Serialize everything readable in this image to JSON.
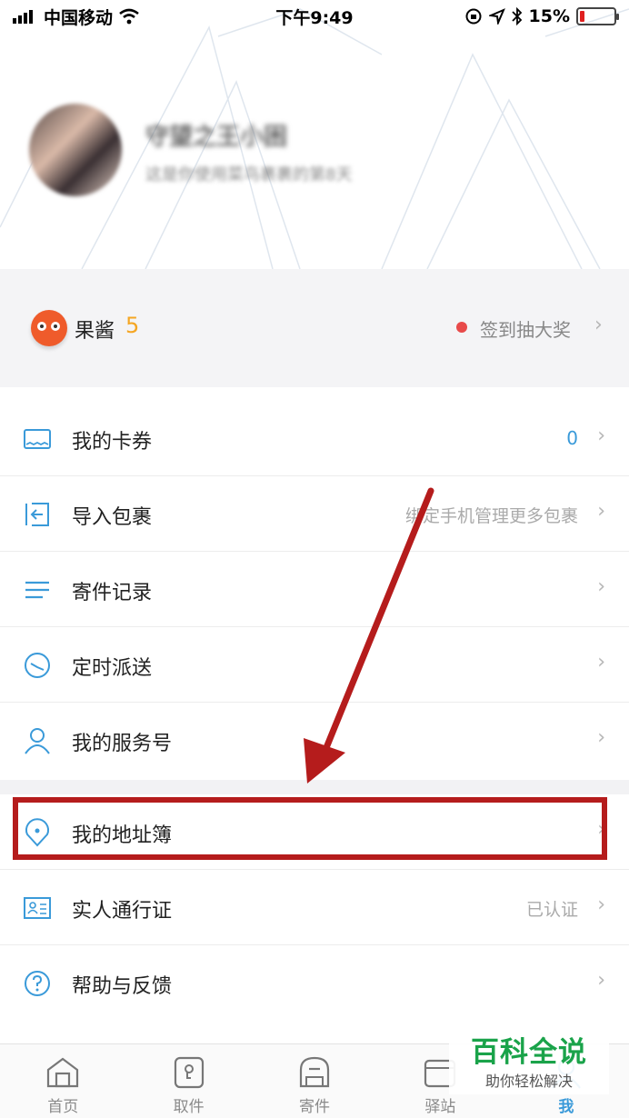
{
  "status_bar": {
    "carrier": "中国移动",
    "time": "下午9:49",
    "battery_percent": "15%",
    "battery_level": 0.15,
    "battery_color": "#e02020"
  },
  "profile": {
    "name": "守望之王小困",
    "days_text": "这是你使用菜鸟裹裹的第8天"
  },
  "points": {
    "label": "果酱",
    "value": "5",
    "checkin_text": "签到抽大奖"
  },
  "menu_group1": [
    {
      "label": "我的卡券",
      "right": "0",
      "icon": "coupon-icon"
    },
    {
      "label": "导入包裹",
      "right": "绑定手机管理更多包裹",
      "icon": "import-icon"
    },
    {
      "label": "寄件记录",
      "right": "",
      "icon": "list-icon"
    },
    {
      "label": "定时派送",
      "right": "",
      "icon": "clock-icon"
    },
    {
      "label": "我的服务号",
      "right": "",
      "icon": "person-icon"
    }
  ],
  "menu_group2": [
    {
      "label": "我的地址簿",
      "right": "",
      "icon": "location-icon"
    },
    {
      "label": "实人通行证",
      "right": "已认证",
      "icon": "id-card-icon"
    },
    {
      "label": "帮助与反馈",
      "right": "",
      "icon": "help-icon"
    }
  ],
  "tabs": [
    {
      "label": "首页",
      "icon": "home-icon"
    },
    {
      "label": "取件",
      "icon": "pickup-icon"
    },
    {
      "label": "寄件",
      "icon": "send-icon"
    },
    {
      "label": "驿站",
      "icon": "station-icon"
    },
    {
      "label": "我",
      "icon": "me-icon"
    }
  ],
  "watermark": {
    "title": "百科全说",
    "subtitle": "助你轻松解决"
  },
  "colors": {
    "accent": "#3a9ad9",
    "points": "#f5a623",
    "annotation": "#b51c1c",
    "watermark": "#1aa34a"
  }
}
